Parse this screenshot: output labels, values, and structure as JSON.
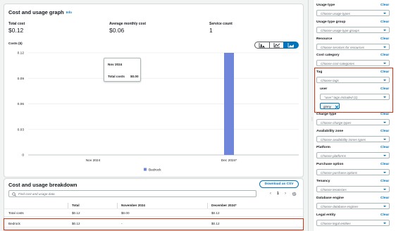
{
  "graph": {
    "title": "Cost and usage graph",
    "info": "Info",
    "stats": [
      {
        "label": "Total cost",
        "value": "$0.12"
      },
      {
        "label": "Average monthly cost",
        "value": "$0.06"
      },
      {
        "label": "Service count",
        "value": "1"
      }
    ],
    "costs_label": "Costs ($)",
    "chart_types": [
      "bar-chart-icon",
      "line-chart-icon",
      "stacked-bar-chart-icon"
    ],
    "tooltip": {
      "title": "Nov 2024",
      "label": "Total costs",
      "value": "$0.00"
    },
    "legend": "Bedrock"
  },
  "chart_data": {
    "type": "bar",
    "categories": [
      "Nov 2024",
      "Dec 2024*"
    ],
    "series": [
      {
        "name": "Bedrock",
        "values": [
          0,
          0.12
        ],
        "color": "#6f86da"
      }
    ],
    "yticks": [
      "0.12",
      "0.09",
      "0.06",
      "0.03",
      "0"
    ],
    "ylabel": "Costs ($)",
    "ylim": [
      0,
      0.12
    ],
    "grid": true,
    "legend": "bottom-center"
  },
  "breakdown": {
    "title": "Cost and usage breakdown",
    "download": "Download as CSV",
    "search_placeholder": "Find cost and usage data",
    "page": "1",
    "columns": [
      "",
      "Total",
      "November 2024",
      "December 2024*"
    ],
    "rows": [
      [
        "Total costs",
        "$0.12",
        "$0.00",
        "$0.12"
      ],
      [
        "Bedrock",
        "$0.12",
        "-",
        "$0.12"
      ]
    ]
  },
  "filters": {
    "clear": "Clear",
    "items": [
      {
        "label": "Usage type",
        "placeholder": "Choose usage types"
      },
      {
        "label": "Usage type group",
        "placeholder": "Choose usage type groups"
      },
      {
        "label": "Resource",
        "placeholder": "Choose services for resources"
      },
      {
        "label": "Cost category",
        "placeholder": "Choose cost categories"
      },
      {
        "label": "Tag",
        "placeholder": "Choose tags"
      },
      {
        "label": "user",
        "placeholder": "\"user\" tags included (1)"
      },
      {
        "label": "Charge type",
        "placeholder": "Choose charge types"
      },
      {
        "label": "Availability zone",
        "placeholder": "Choose availability zones types"
      },
      {
        "label": "Platform",
        "placeholder": "Choose platforms"
      },
      {
        "label": "Purchase option",
        "placeholder": "Choose purchase options"
      },
      {
        "label": "Tenancy",
        "placeholder": "Choose tenancies"
      },
      {
        "label": "Database engine",
        "placeholder": "Choose database engines"
      },
      {
        "label": "Legal entity",
        "placeholder": "Choose legal entities"
      }
    ],
    "token": "ginny"
  },
  "colors": {
    "accent": "#0073bb",
    "bar": "#6f86da",
    "highlight": "#d13212"
  }
}
